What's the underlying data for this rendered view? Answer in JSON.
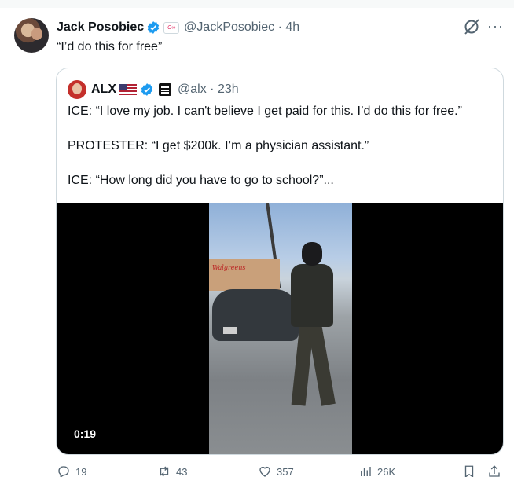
{
  "tweet": {
    "author_name": "Jack Posobiec",
    "handle": "@JackPosobiec",
    "time": "4h",
    "separator": "·",
    "affiliate_badge": "C∞",
    "text": "“I’d do this for free”",
    "more": "···"
  },
  "quoted": {
    "author_name": "ALX",
    "handle": "@alx",
    "time": "23h",
    "separator": "·",
    "lines": [
      "ICE: “I love my job. I can't believe I get paid for this. I’d do this for free.”",
      "PROTESTER: “I get $200k. I’m a physician assistant.”",
      "ICE: “How long did you have to go to school?”..."
    ],
    "video": {
      "duration": "0:19",
      "store_sign": "Walgreens"
    }
  },
  "actions": {
    "replies": "19",
    "reposts": "43",
    "likes": "357",
    "views": "26K"
  },
  "colors": {
    "verified": "#1d9bf0",
    "muted": "#536471",
    "border": "#cfd9de"
  },
  "icons": {
    "verified": "verified-badge-icon",
    "grok": "grok-icon",
    "reply": "reply-icon",
    "repost": "repost-icon",
    "like": "heart-icon",
    "views": "views-chart-icon",
    "bookmark": "bookmark-icon",
    "share": "share-icon"
  }
}
